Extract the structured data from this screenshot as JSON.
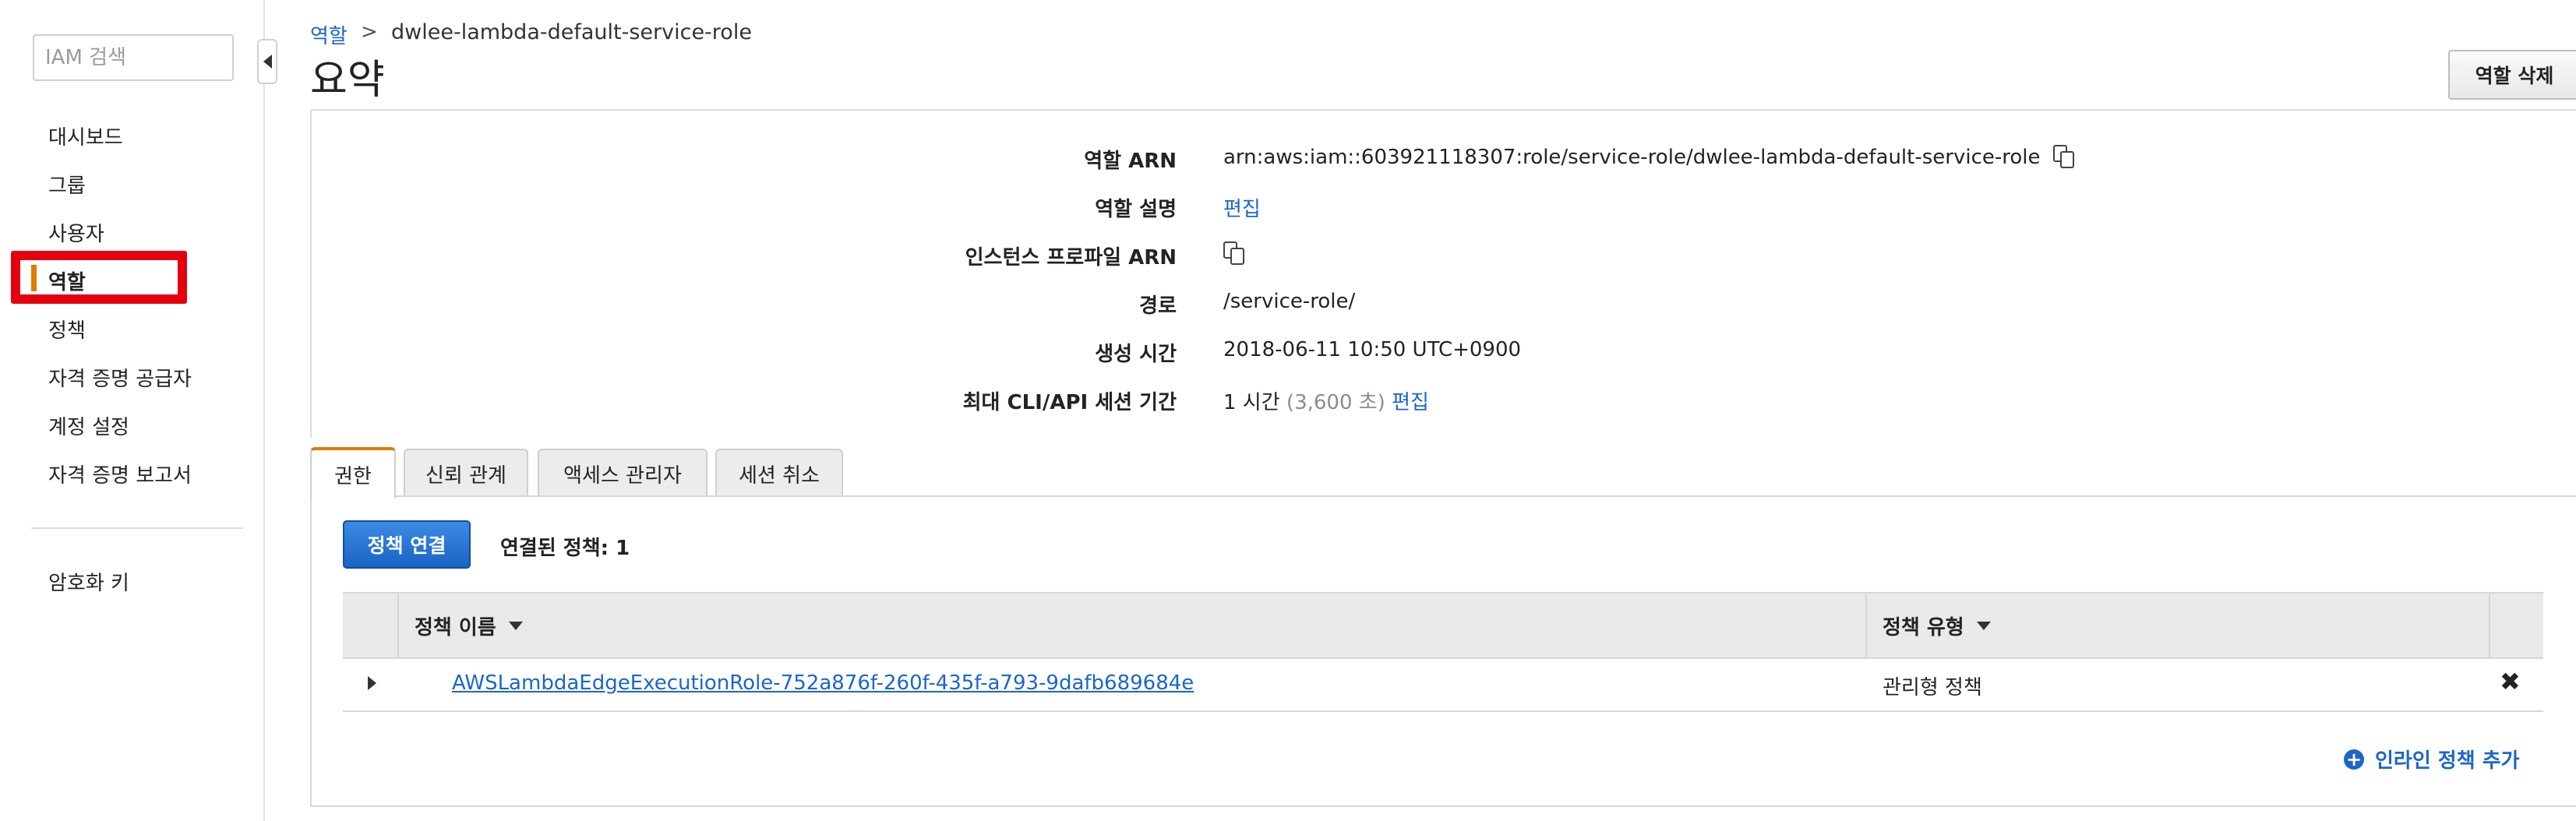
{
  "sidebar": {
    "search_placeholder": "IAM 검색",
    "items": [
      {
        "label": "대시보드"
      },
      {
        "label": "그룹"
      },
      {
        "label": "사용자"
      },
      {
        "label": "역할",
        "active": true
      },
      {
        "label": "정책"
      },
      {
        "label": "자격 증명 공급자"
      },
      {
        "label": "계정 설정"
      },
      {
        "label": "자격 증명 보고서"
      }
    ],
    "extra_items": [
      {
        "label": "암호화 키"
      }
    ]
  },
  "breadcrumb": {
    "parent": "역할",
    "separator": ">",
    "current": "dwlee-lambda-default-service-role"
  },
  "header": {
    "title": "요약",
    "delete_button": "역할 삭제"
  },
  "summary": {
    "role_arn_label": "역할 ARN",
    "role_arn_value": "arn:aws:iam::603921118307:role/service-role/dwlee-lambda-default-service-role",
    "role_desc_label": "역할 설명",
    "role_desc_edit": "편집",
    "instance_profile_label": "인스턴스 프로파일 ARN",
    "path_label": "경로",
    "path_value": "/service-role/",
    "created_label": "생성 시간",
    "created_value": "2018-06-11 10:50 UTC+0900",
    "session_label": "최대 CLI/API 세션 기간",
    "session_value": "1 시간",
    "session_seconds": "(3,600 초)",
    "session_edit": "편집"
  },
  "tabs": [
    {
      "label": "권한",
      "active": true
    },
    {
      "label": "신뢰 관계"
    },
    {
      "label": "액세스 관리자"
    },
    {
      "label": "세션 취소"
    }
  ],
  "permissions": {
    "attach_button": "정책 연결",
    "attached_count": "연결된 정책: 1",
    "columns": {
      "name": "정책 이름",
      "type": "정책 유형"
    },
    "rows": [
      {
        "name": "AWSLambdaEdgeExecutionRole-752a876f-260f-435f-a793-9dafb689684e",
        "type": "관리형 정책",
        "remove": "✖"
      }
    ],
    "add_inline": "인라인 정책 추가",
    "add_inline_icon": "+"
  },
  "colors": {
    "link": "#1b66c9",
    "accent_orange": "#e07b00",
    "highlight_red": "#e3000f",
    "primary_button": "#1a63c4"
  }
}
